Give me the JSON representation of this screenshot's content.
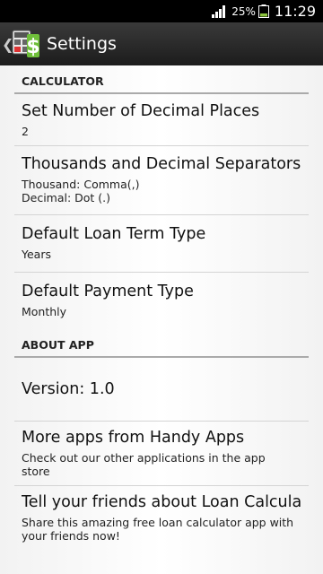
{
  "status_bar": {
    "battery_percent": "25%",
    "time": "11:29"
  },
  "action_bar": {
    "back_glyph": "❮",
    "title": "Settings",
    "icon": "calculator-dollar-app-icon"
  },
  "sections": [
    {
      "header": "CALCULATOR",
      "items": [
        {
          "title": "Set Number of Decimal Places",
          "summary": [
            "2"
          ]
        },
        {
          "title": "Thousands and Decimal Separators",
          "summary": [
            "Thousand: Comma(,)",
            "Decimal: Dot (.)"
          ]
        },
        {
          "title": "Default Loan Term Type",
          "summary": [
            "Years"
          ]
        },
        {
          "title": "Default Payment Type",
          "summary": [
            "Monthly"
          ]
        }
      ]
    },
    {
      "header": "ABOUT APP",
      "items": [
        {
          "title": "Version: 1.0",
          "summary": []
        },
        {
          "title": "More apps from Handy Apps",
          "summary": [
            "Check out our other applications in the app",
            "store"
          ]
        },
        {
          "title": "Tell your friends about Loan Calculator",
          "summary": [
            "Share this amazing free loan calculator app with",
            "your friends now!"
          ]
        }
      ]
    }
  ]
}
